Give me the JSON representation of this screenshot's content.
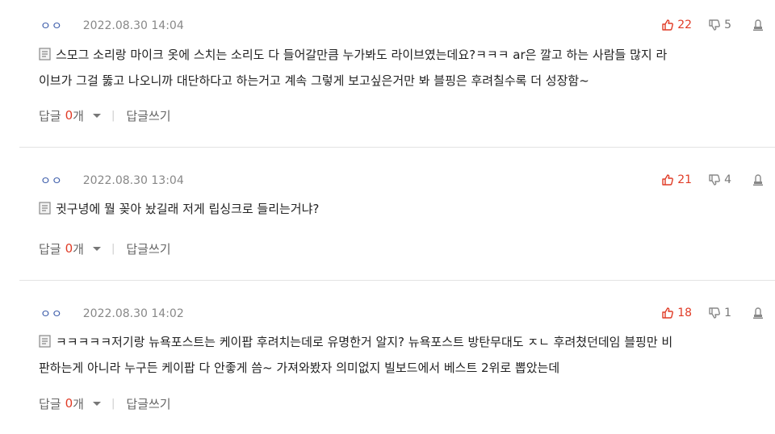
{
  "comments": [
    {
      "nickname": "ㅇㅇ",
      "date": "2022.08.30 14:04",
      "likes": "22",
      "dislikes": "5",
      "text_lines": [
        "스모그 소리랑 마이크 옷에 스치는 소리도 다 들어갈만큼 누가봐도 라이브였는데요?ㅋㅋㅋ ar은 깔고 하는 사람들 많지 라",
        "이브가 그걸 뚫고 나오니까 대단하다고 하는거고 계속 그렇게 보고싶은거만 봐 블핑은 후려칠수록 더 성장함~"
      ],
      "reply_label": "답글",
      "reply_count": "0",
      "reply_unit": "개",
      "write_label": "답글쓰기"
    },
    {
      "nickname": "ㅇㅇ",
      "date": "2022.08.30 13:04",
      "likes": "21",
      "dislikes": "4",
      "text_lines": [
        "귓구녕에 뭘 꽂아 놨길래 저게 립싱크로 들리는거냐?"
      ],
      "reply_label": "답글",
      "reply_count": "0",
      "reply_unit": "개",
      "write_label": "답글쓰기"
    },
    {
      "nickname": "ㅇㅇ",
      "date": "2022.08.30 14:02",
      "likes": "18",
      "dislikes": "1",
      "text_lines": [
        "ㅋㅋㅋㅋㅋ저기랑 뉴욕포스트는 케이팝 후려치는데로 유명한거 알지? 뉴욕포스트 방탄무대도 ㅈㄴ 후려쳤던데임 블핑만 비",
        "판하는게 아니라 누구든 케이팝 다 안좋게 씀~ 가져와봤자 의미없지 빌보드에서 베스트 2위로 뽑았는데"
      ],
      "reply_label": "답글",
      "reply_count": "0",
      "reply_unit": "개",
      "write_label": "답글쓰기"
    }
  ],
  "colors": {
    "like": "#e03b26",
    "dislike": "#777777",
    "nickname": "#3b5ba9",
    "separator": "#e3e3e3"
  },
  "icons": {
    "like": "thumbs-up-icon",
    "dislike": "thumbs-down-icon",
    "report": "report-icon",
    "memo": "memo-icon",
    "caret": "caret-down-icon"
  }
}
